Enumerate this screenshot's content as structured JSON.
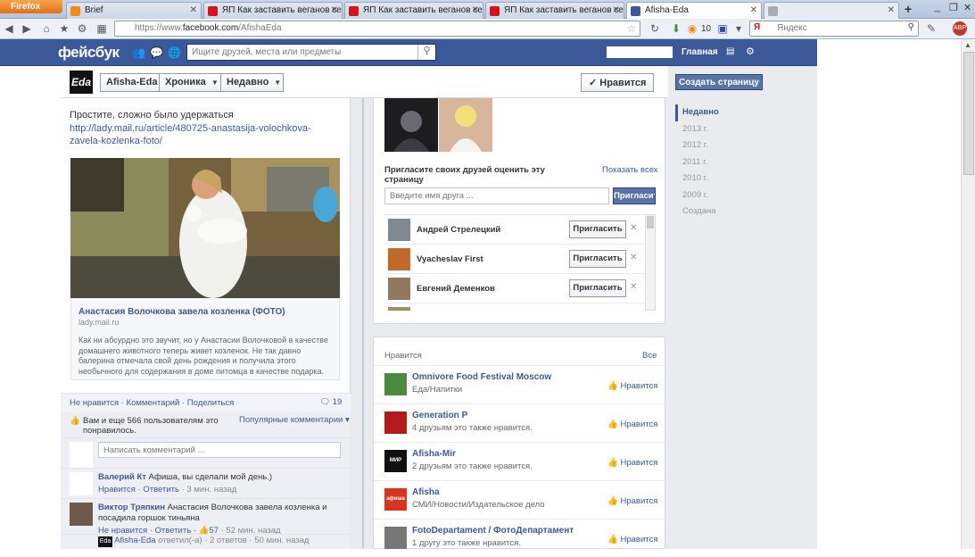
{
  "browser": {
    "menu_button": "Firefox",
    "tabs": [
      {
        "title": "Brief",
        "color": "#f28a1c"
      },
      {
        "title": "ЯП Как заставить веганов себ...",
        "color": "#d6121b"
      },
      {
        "title": "ЯП Как заставить веганов себ...",
        "color": "#d6121b"
      },
      {
        "title": "ЯП Как заставить веганов себ...",
        "color": "#d6121b"
      },
      {
        "title": "Afisha-Eda",
        "color": "#3b5998"
      }
    ],
    "new_tab": "+",
    "url_prefix": "https://www.",
    "url_host": "facebook.com",
    "url_path": "/AfishaEda",
    "downloads_count": "10",
    "search_placeholder": "Яндекс",
    "window_controls": [
      "_",
      "❐",
      "✕"
    ]
  },
  "fb": {
    "logo": "фейсбук",
    "search_placeholder": "Ищите друзей, места или предметы",
    "home": "Главная"
  },
  "page_header": {
    "logo_text": "Еda",
    "page_name": "Afisha-Eda",
    "timeline": "Хроника",
    "recent": "Недавно",
    "liked": "✓ Нравится",
    "create_page": "Создать страницу"
  },
  "post": {
    "text": "Простите, сложно было удержаться",
    "link": "http://lady.mail.ru/article/480725-anastasija-volochkova-zavela-kozlenka-foto/",
    "card_title": "Анастасия Волочкова завела козленка (ФОТО)",
    "card_domain": "lady.mail.ru",
    "card_desc": "Как ни абсурдно это звучит, но у Анастасии Волочковой в качестве домашнего животного теперь живет козленок. Не так давно балерина отмечала свой день рождения и получила этого необычного для содержания в доме питомца в качестве подарка.",
    "actions": "Не нравится · Комментарий · Поделиться",
    "comments_count": "19",
    "likes_text": "Вам и еще 566 пользователям это понравилось.",
    "popular": "Популярные комментарии ▾",
    "comment_placeholder": "Написать комментарий ...",
    "comments": [
      {
        "name": "Валерий Кт",
        "text": " Афиша, вы сделали мой день.)",
        "meta": "Нравится · Ответить",
        "time": " · 3 мин. назад"
      },
      {
        "name": "Виктор Тряпкин",
        "text": " Анастасия Волочкова завела козленка и посадила горшок тиньяна",
        "meta": "Не нравится · Ответить · 👍57",
        "time": " · 52 мин. назад"
      },
      {
        "name": "Afisha-Eda",
        "text": " ответил(-а) · 2 ответов · 50 мин. назад",
        "meta": "",
        "time": ""
      }
    ]
  },
  "invite": {
    "title": "Пригласите своих друзей оценить эту страницу",
    "show_all": "Показать всех",
    "input_placeholder": "Введите имя друга ...",
    "button": "Пригласить",
    "friends": [
      {
        "name": "Андрей Стрелецкий",
        "btn": "Пригласить",
        "color": "#7e8a92"
      },
      {
        "name": "Vyacheslav First",
        "btn": "Пригласить",
        "color": "#c06b2c"
      },
      {
        "name": "Евгений Деменков",
        "btn": "Пригласить",
        "color": "#8f7a60"
      }
    ]
  },
  "likes": {
    "title": "Нравится",
    "all": "Все",
    "items": [
      {
        "name": "Omnivore Food Festival Moscow",
        "sub": "Еда/Напитки",
        "like": "Нравится",
        "color": "#4c8b3d",
        "avatar_text": ""
      },
      {
        "name": "Generation P",
        "sub": "4 друзьям это также нравится.",
        "like": "Нравится",
        "color": "#b51a1a",
        "avatar_text": ""
      },
      {
        "name": "Afisha-Mir",
        "sub": "2 друзьям это также нравится.",
        "like": "Нравится",
        "color": "#111111",
        "avatar_text": "МИР"
      },
      {
        "name": "Afisha",
        "sub": "СМИ/Новости/Издательское дело",
        "like": "Нравится",
        "color": "#d9341d",
        "avatar_text": "афиша"
      },
      {
        "name": "FotoDepartament / ФотоДепартамент",
        "sub": "1 другу это также нравится.",
        "like": "Нравится",
        "color": "#777777",
        "avatar_text": ""
      }
    ]
  },
  "years": [
    "Недавно",
    "2013 г.",
    "2012 г.",
    "2011 г.",
    "2010 г.",
    "2009 г.",
    "Создана"
  ]
}
